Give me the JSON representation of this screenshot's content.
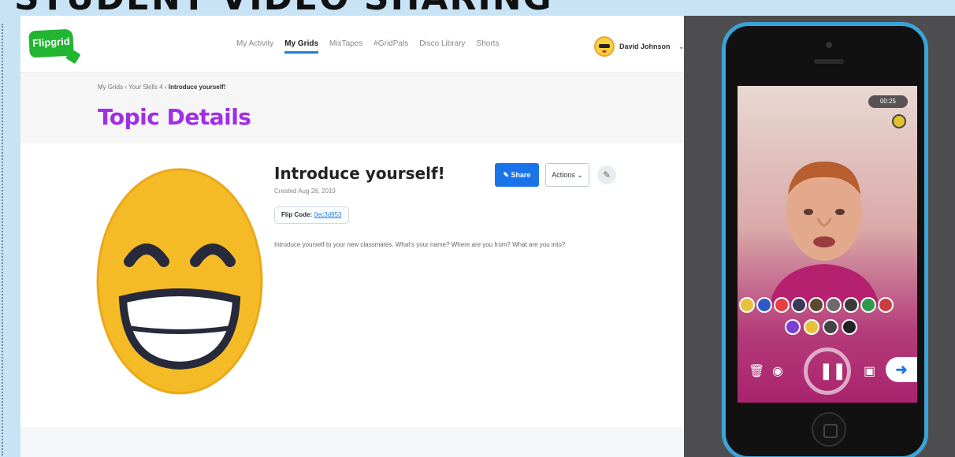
{
  "slide": {
    "heading": "STUDENT VIDEO SHARING"
  },
  "app": {
    "logo_text": "Flipgrid",
    "nav": [
      "My Activity",
      "My Grids",
      "MixTapes",
      "#GridPals",
      "Disco Library",
      "Shorts"
    ],
    "active_nav": "My Grids",
    "user_name": "David Johnson"
  },
  "page": {
    "breadcrumb": [
      "My Grids",
      "Your Skills 4",
      "Introduce yourself!"
    ],
    "title": "Topic Details"
  },
  "topic": {
    "title": "Introduce yourself!",
    "created": "Created Aug 28, 2019",
    "flip_code_label": "Flip Code:",
    "flip_code": "0ec3d953",
    "prompt": "Introduce yourself to your new classmates. What's your name? Where are you from? What are you into?",
    "share_label": "Share",
    "actions_label": "Actions"
  },
  "phone": {
    "timer": "00:25"
  },
  "colors": {
    "accent": "#1a73e8",
    "title_purple": "#a22de8",
    "brand_green": "#21b531",
    "phone_frame": "#3aa3d9"
  },
  "icons": {
    "logo": "flipgrid-logo",
    "pen": "pen-icon",
    "trash": "trash-icon",
    "camera": "camera-icon",
    "image": "image-icon",
    "next": "arrow-right-icon",
    "pause": "pause-icon"
  }
}
